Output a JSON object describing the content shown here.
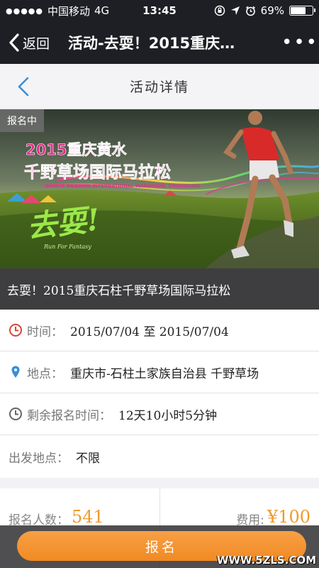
{
  "status_bar": {
    "signal": "●●●●●",
    "carrier": "中国移动",
    "network": "4G",
    "time": "13:45",
    "battery": "69%",
    "battery_level": 0.69
  },
  "nav": {
    "back_label": "返回",
    "title": "活动-去耍！2015重庆…",
    "more_label": "•••"
  },
  "sub_header": {
    "title": "活动详情"
  },
  "banner": {
    "status_tag": "报名中",
    "headline_line1": "2015重庆黄水",
    "headline_line2": "千野草场国际马拉松",
    "subline": "QIANYE MEADOW INTERNATIONAL MARATHON, CHONGQING",
    "slogan": "去耍!",
    "slogan_sub": "Run For Fantasy"
  },
  "event": {
    "title": "去耍！2015重庆石柱千野草场国际马拉松"
  },
  "info": {
    "time_label": "时间：",
    "time_value": "2015/07/04 至 2015/07/04",
    "location_label": "地点：",
    "location_value": "重庆市-石柱土家族自治县 千野草场",
    "remaining_label": "剩余报名时间：",
    "remaining_value": "12天10小时5分钟",
    "departure_label": "出发地点：",
    "departure_value": "不限"
  },
  "stats": {
    "signups_label": "报名人数：",
    "signups_value": "541",
    "fee_label": "费用:",
    "fee_value": "¥100"
  },
  "signup_button": "报名",
  "watermark": "WWW.5ZLS.COM",
  "colors": {
    "accent": "#f18a23",
    "dark_bar": "#1e1f24",
    "link_blue": "#3a8fd8",
    "time_icon_red": "#d9453a"
  }
}
